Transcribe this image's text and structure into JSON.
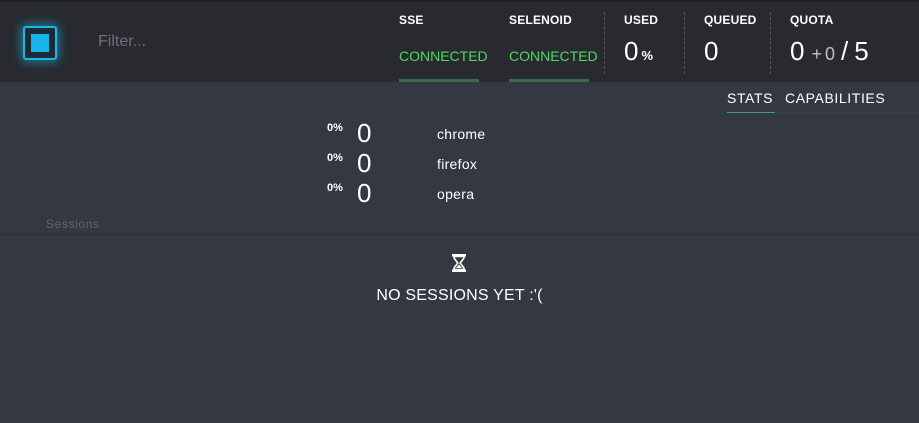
{
  "header": {
    "filter_placeholder": "Filter...",
    "sse": {
      "label": "SSE",
      "status": "CONNECTED"
    },
    "selenoid": {
      "label": "SELENOID",
      "status": "CONNECTED"
    },
    "used": {
      "label": "USED",
      "value": "0",
      "unit": "%"
    },
    "queued": {
      "label": "QUEUED",
      "value": "0"
    },
    "quota": {
      "label": "QUOTA",
      "value": "0",
      "plus": "+",
      "pending": "0",
      "slash": "/",
      "total": "5"
    }
  },
  "tabs": [
    {
      "label": "STATS",
      "active": true
    },
    {
      "label": "CAPABILITIES",
      "active": false
    }
  ],
  "stats": [
    {
      "percent": "0%",
      "count": "0",
      "browser": "chrome"
    },
    {
      "percent": "0%",
      "count": "0",
      "browser": "firefox"
    },
    {
      "percent": "0%",
      "count": "0",
      "browser": "opera"
    }
  ],
  "sessions": {
    "label": "Sessions",
    "empty_icon": "hourglass-icon",
    "empty_message": "NO SESSIONS YET :'("
  },
  "colors": {
    "accent": "#18b3ec",
    "connected": "#4cd964",
    "tab_active": "#3f9f74"
  }
}
